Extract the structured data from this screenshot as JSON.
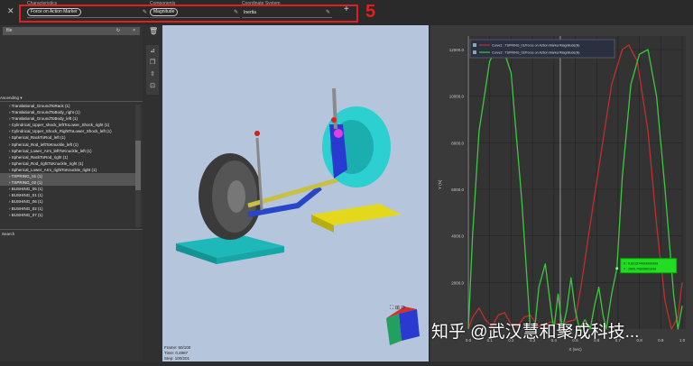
{
  "topbar": {
    "close_icon": "close-icon",
    "characteristics_label": "Characteristics",
    "characteristics_value": "Force on Action Marker",
    "components_label": "Components",
    "components_value": "Magnitude",
    "coord_label": "Coordinate System",
    "coord_value": "Inertia",
    "annotation": "5"
  },
  "left": {
    "search_value": "file",
    "sort_label": "Ascending",
    "search_section": "Search",
    "items": [
      "Translational_GroundToRack (1)",
      "Translational_GroundToBody_right (1)",
      "Translational_GroundToBody_left (1)",
      "Cylindrical_Upper_shock_leftToLower_Shock_right (1)",
      "Cylindrical_Upper_Shock_RightToLower_Shock_left (1)",
      "Spherical_RackToRod_left (1)",
      "Spherical_Rod_leftToKnuckle_left (1)",
      "Spherical_Lower_Arm_leftToKnuckle_left (1)",
      "Spherical_RackToRod_right (1)",
      "Spherical_Rod_rightToKnuckle_right (1)",
      "Spherical_Lower_Arm_rightToKnuckle_right (1)",
      "TSPRING_01 (1)",
      "TSPRING_02 (1)",
      "BUSHING_05 (1)",
      "BUSHING_01 (1)",
      "BUSHING_06 (1)",
      "BUSHING_02 (1)",
      "BUSHING_07 (1)"
    ],
    "selected": [
      11,
      12
    ]
  },
  "viewport": {
    "frame": "Frame: 50/100",
    "time": "Time: 0.4987",
    "step": "Step: 100/201",
    "watermark": "知乎 @武汉慧和聚成科技..."
  },
  "chart_data": {
    "type": "line",
    "xlabel": "X (sec)",
    "ylabel": "Y (N)",
    "xlim": [
      0,
      1
    ],
    "ylim": [
      0,
      12000
    ],
    "xticks": [
      "0.0",
      "0.1",
      "0.2",
      "0.3",
      "0.4",
      "0.5",
      "0.6",
      "0.7",
      "0.8",
      "0.9",
      "1.0"
    ],
    "yticks": [
      "2000.0",
      "4000.0",
      "6000.0",
      "8000.0",
      "10000.0",
      "12000.0"
    ],
    "grid": true,
    "legend": "top-left",
    "series": [
      {
        "name": "Curve1 : TSPRING_01/Force on Action Marker/Magnitude(N)",
        "color": "#c0302c",
        "x": [
          0,
          0.02,
          0.05,
          0.08,
          0.11,
          0.14,
          0.17,
          0.2,
          0.23,
          0.26,
          0.29,
          0.32,
          0.35,
          0.38,
          0.42,
          0.46,
          0.5,
          0.53,
          0.57,
          0.62,
          0.67,
          0.72,
          0.75,
          0.79,
          0.84,
          0.88,
          0.92,
          0.95,
          0.98,
          1.0
        ],
        "y": [
          0,
          500,
          900,
          400,
          100,
          600,
          700,
          200,
          100,
          500,
          600,
          200,
          0,
          300,
          200,
          300,
          400,
          2000,
          4500,
          7500,
          10500,
          12000,
          12200,
          11500,
          8500,
          4500,
          1200,
          0,
          500,
          2000
        ]
      },
      {
        "name": "Curve2 : TSPRING_02/Force on Action Marker/Magnitude(N)",
        "color": "#3ec83e",
        "x": [
          0,
          0.02,
          0.05,
          0.1,
          0.15,
          0.2,
          0.25,
          0.29,
          0.31,
          0.33,
          0.36,
          0.39,
          0.4,
          0.42,
          0.44,
          0.46,
          0.48,
          0.5,
          0.52,
          0.545,
          0.57,
          0.59,
          0.61,
          0.63,
          0.645,
          0.67,
          0.695,
          0.72,
          0.76,
          0.8,
          0.84,
          0.88,
          0.92,
          0.96,
          0.98,
          1.0
        ],
        "y": [
          0,
          4000,
          8500,
          11500,
          12400,
          11000,
          5500,
          0,
          0,
          1800,
          2800,
          600,
          0,
          1500,
          0,
          800,
          2200,
          800,
          0,
          400,
          0,
          1000,
          1800,
          600,
          0,
          1500,
          2600,
          6500,
          10500,
          11800,
          12000,
          10000,
          6000,
          1500,
          0,
          1000
        ]
      }
    ],
    "tooltip": {
      "x": "X : 0.631574999999999",
      "y": "Y : 2605.70605891649"
    }
  }
}
